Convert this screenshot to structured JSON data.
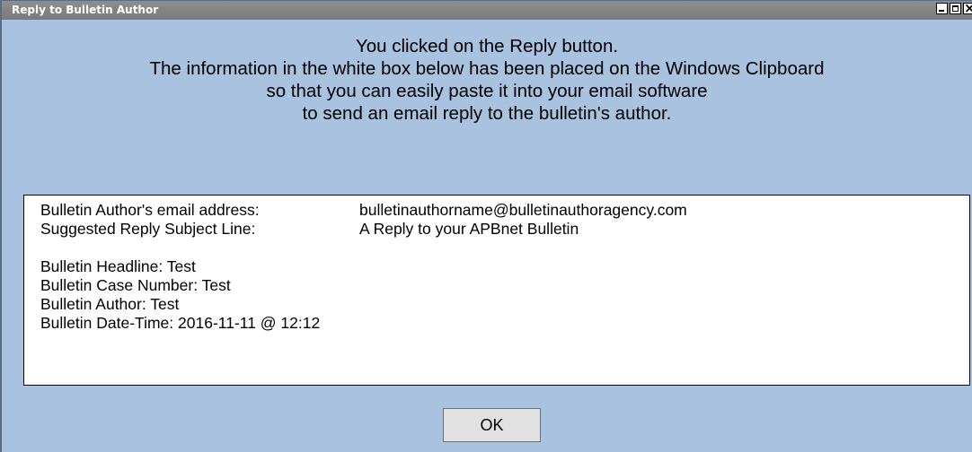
{
  "window": {
    "title": "Reply to Bulletin Author"
  },
  "message": {
    "lines": [
      "You clicked on the Reply button.",
      "The information in the white box below has been placed on the Windows Clipboard",
      "so that you can easily paste it into your email software",
      "to send an email reply to the bulletin's author."
    ]
  },
  "info": {
    "email_label": "Bulletin Author's email address:",
    "email_value": "bulletinauthorname@bulletinauthoragency.com",
    "subject_label": "Suggested Reply Subject Line:",
    "subject_value": "A Reply to your APBnet Bulletin",
    "headline": "Bulletin Headline:  Test",
    "case_number": "Bulletin Case Number:  Test",
    "author": "Bulletin Author:  Test",
    "datetime": "Bulletin Date-Time:  2016-11-11 @ 12:12"
  },
  "buttons": {
    "ok_label": "OK"
  }
}
